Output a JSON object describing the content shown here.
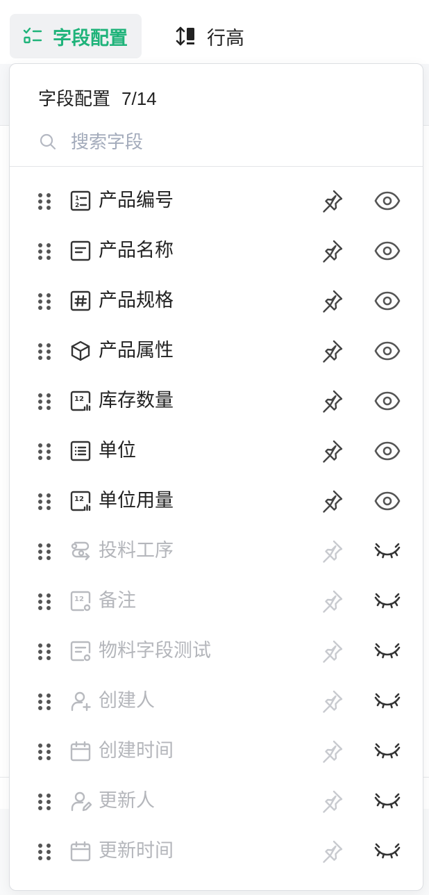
{
  "toolbar": {
    "field_config_label": "字段配置",
    "row_height_label": "行高",
    "accent": "#1fb37a"
  },
  "panel": {
    "title": "字段配置",
    "count": "7/14",
    "search_placeholder": "搜索字段"
  },
  "fields": [
    {
      "name": "产品编号",
      "icon": "numbered-list-icon",
      "visible": true
    },
    {
      "name": "产品名称",
      "icon": "text-field-icon",
      "visible": true
    },
    {
      "name": "产品规格",
      "icon": "hash-icon",
      "visible": true
    },
    {
      "name": "产品属性",
      "icon": "cube-icon",
      "visible": true
    },
    {
      "name": "库存数量",
      "icon": "number-chart-icon",
      "visible": true
    },
    {
      "name": "单位",
      "icon": "list-icon",
      "visible": true
    },
    {
      "name": "单位用量",
      "icon": "number-chart-icon",
      "visible": true
    },
    {
      "name": "投料工序",
      "icon": "process-flow-icon",
      "visible": false
    },
    {
      "name": "备注",
      "icon": "number-formula-icon",
      "visible": false
    },
    {
      "name": "物料字段测试",
      "icon": "text-formula-icon",
      "visible": false
    },
    {
      "name": "创建人",
      "icon": "user-add-icon",
      "visible": false
    },
    {
      "name": "创建时间",
      "icon": "calendar-icon",
      "visible": false
    },
    {
      "name": "更新人",
      "icon": "user-edit-icon",
      "visible": false
    },
    {
      "name": "更新时间",
      "icon": "calendar-icon",
      "visible": false
    }
  ],
  "colors": {
    "visible_icon": "#333333",
    "hidden_icon": "#b8babf",
    "eye_visible": "#555555",
    "eye_hidden": "#333333"
  }
}
